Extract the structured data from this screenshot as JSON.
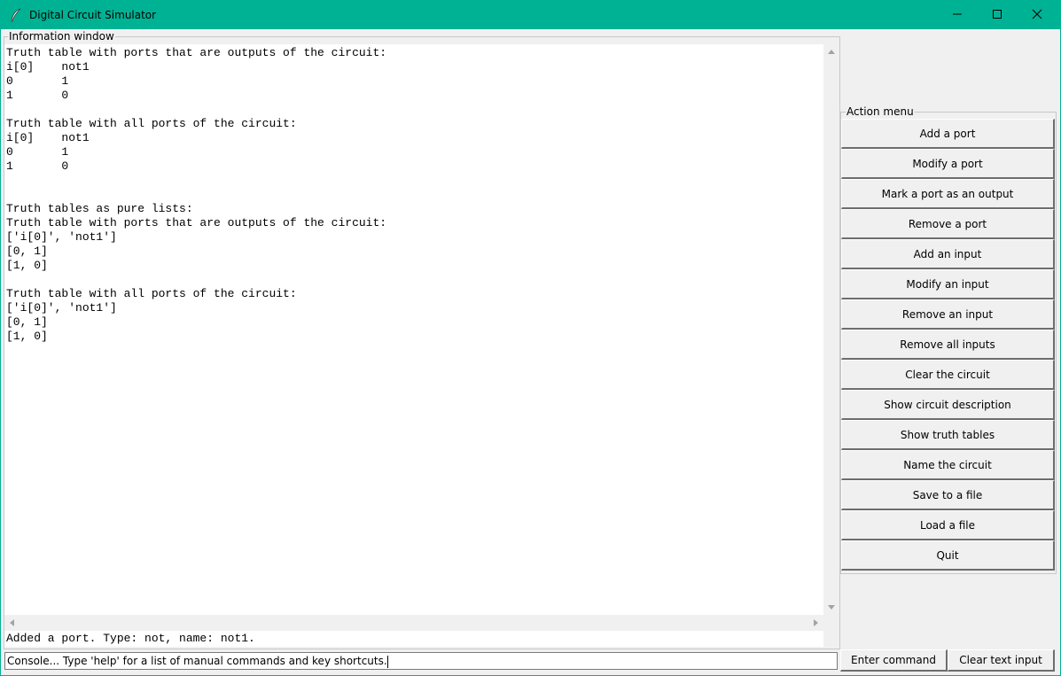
{
  "window": {
    "title": "Digital Circuit Simulator"
  },
  "info": {
    "legend": "Information window",
    "lines": [
      "Truth table with ports that are outputs of the circuit:",
      "i[0]    not1",
      "0       1",
      "1       0",
      "",
      "Truth table with all ports of the circuit:",
      "i[0]    not1",
      "0       1",
      "1       0",
      "",
      "",
      "Truth tables as pure lists:",
      "Truth table with ports that are outputs of the circuit:",
      "['i[0]', 'not1']",
      "[0, 1]",
      "[1, 0]",
      "",
      "Truth table with all ports of the circuit:",
      "['i[0]', 'not1']",
      "[0, 1]",
      "[1, 0]"
    ],
    "status": "Added a port. Type: not, name: not1."
  },
  "action_menu": {
    "legend": "Action menu",
    "buttons": [
      "Add a port",
      "Modify a port",
      "Mark a port as an output",
      "Remove a port",
      "Add an input",
      "Modify an input",
      "Remove an input",
      "Remove all inputs",
      "Clear the circuit",
      "Show circuit description",
      "Show truth tables",
      "Name the circuit",
      "Save to a file",
      "Load a file",
      "Quit"
    ]
  },
  "console": {
    "value": "Console... Type 'help' for a list of manual commands and key shortcuts.",
    "enter_label": "Enter command",
    "clear_label": "Clear text input"
  },
  "colors": {
    "titlebar": "#00b294"
  }
}
